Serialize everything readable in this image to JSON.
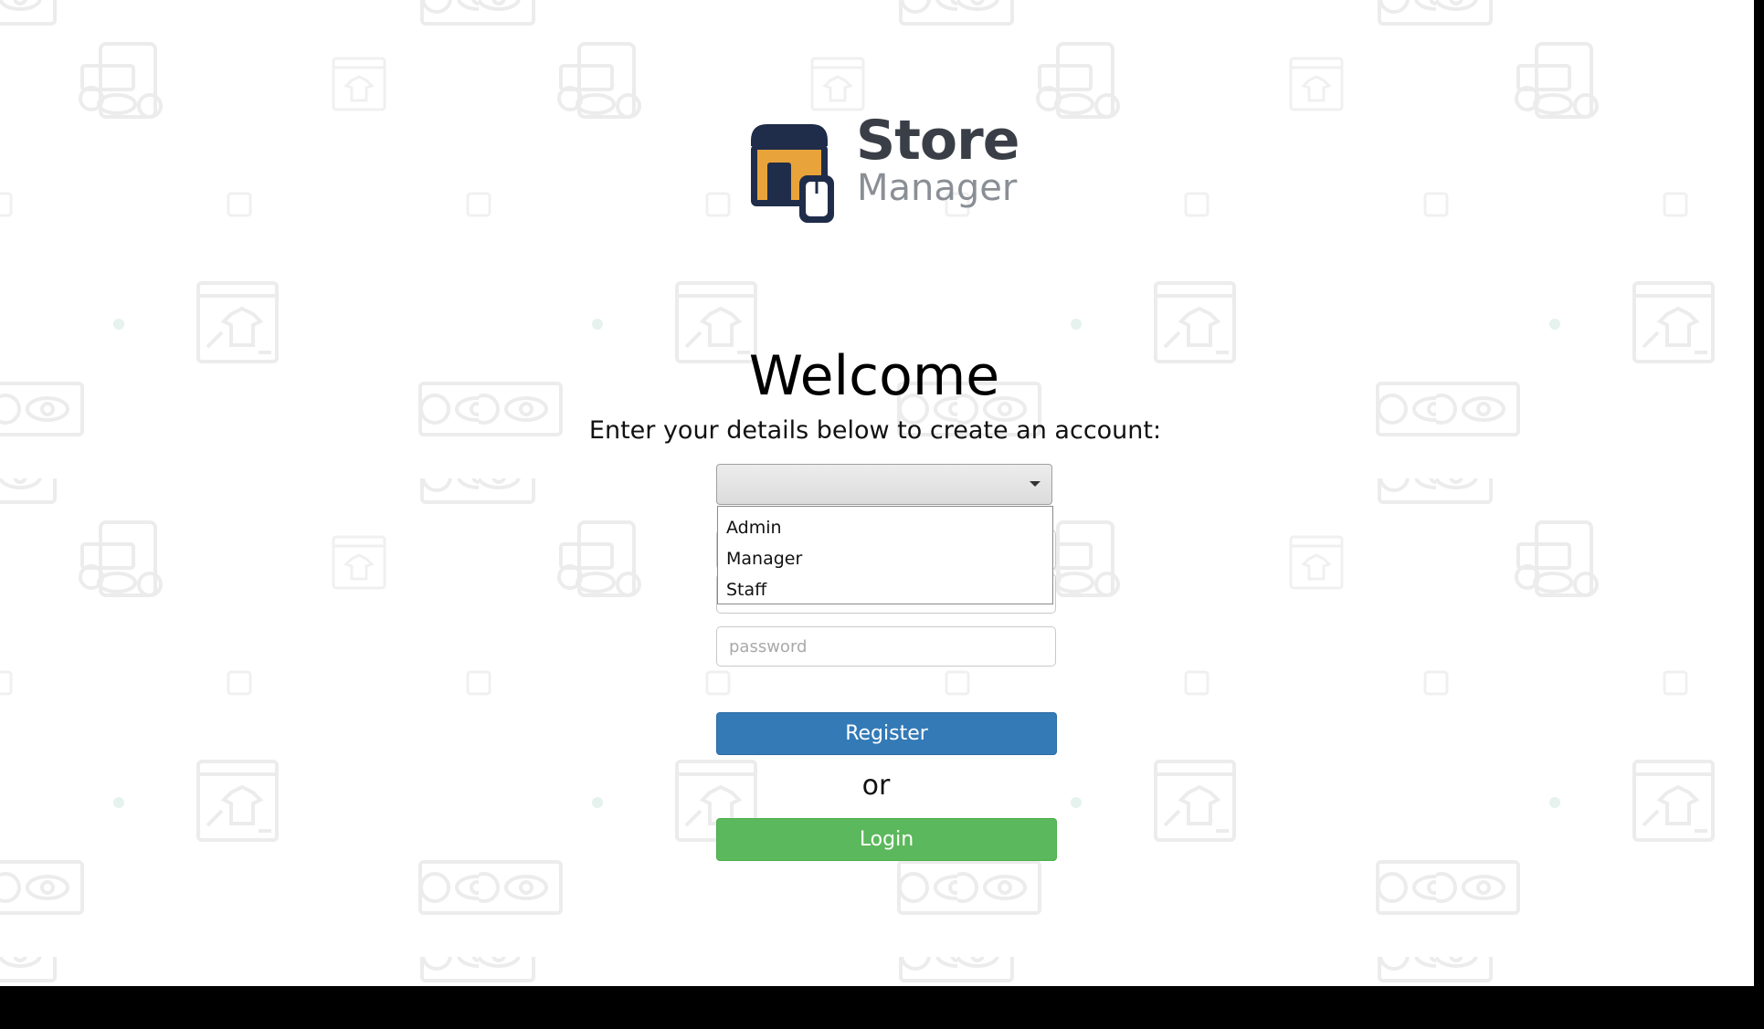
{
  "brand": {
    "title": "Store",
    "subtitle": "Manager"
  },
  "welcome": {
    "heading": "Welcome",
    "instructions": "Enter your details below to create an account:"
  },
  "role_select": {
    "selected": "",
    "options": [
      "Admin",
      "Manager",
      "Staff"
    ]
  },
  "form": {
    "password_placeholder": "password"
  },
  "buttons": {
    "register": "Register",
    "or": "or",
    "login": "Login"
  },
  "colors": {
    "register_bg": "#337ab7",
    "login_bg": "#5cb85c",
    "logo_dark": "#1f2d4a",
    "logo_accent": "#e8a43a"
  }
}
